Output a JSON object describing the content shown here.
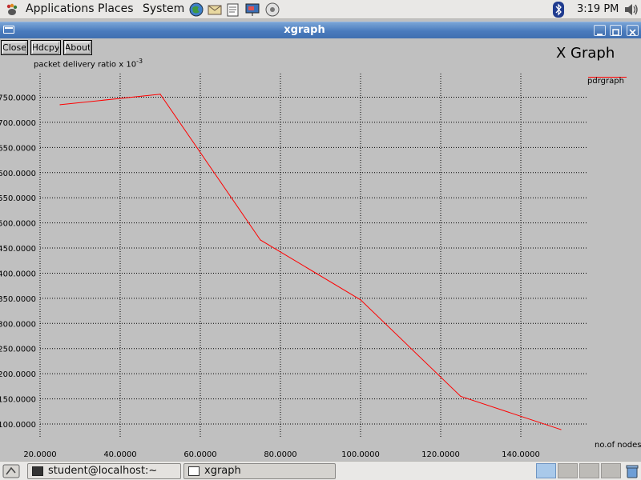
{
  "top_panel": {
    "menus": [
      "Applications",
      "Places",
      "System"
    ],
    "launchers": [
      "web-browser-icon",
      "mail-icon",
      "text-editor-icon",
      "presentation-icon",
      "help-icon"
    ],
    "clock": "3:19 PM"
  },
  "window": {
    "title": "xgraph"
  },
  "xgraph": {
    "buttons": {
      "close": "Close",
      "hdcpy": "Hdcpy",
      "about": "About"
    },
    "title": "X Graph",
    "y_label": "packet delivery ratio x 10",
    "y_label_exp": "-3",
    "x_label": "no.of nodes",
    "legend": "pdrgraph"
  },
  "chart_data": {
    "type": "line",
    "title": "X Graph",
    "xlabel": "no.of nodes",
    "ylabel": "packet delivery ratio x 10^-3",
    "x_ticks": [
      20,
      40,
      60,
      80,
      100,
      120,
      140
    ],
    "y_ticks": [
      100,
      150,
      200,
      250,
      300,
      350,
      400,
      450,
      500,
      550,
      600,
      650,
      700,
      750
    ],
    "x_tick_labels": [
      "20.0000",
      "40.0000",
      "60.0000",
      "80.0000",
      "100.0000",
      "120.0000",
      "140.0000"
    ],
    "y_tick_labels": [
      "100.0000",
      "150.0000",
      "200.0000",
      "250.0000",
      "300.0000",
      "350.0000",
      "400.0000",
      "450.0000",
      "500.0000",
      "550.0000",
      "600.0000",
      "650.0000",
      "700.0000",
      "750.0000"
    ],
    "xlim": [
      20,
      150
    ],
    "ylim": [
      90,
      760
    ],
    "grid": true,
    "legend_position": "top-right",
    "series": [
      {
        "name": "pdrgraph",
        "color": "#ff0000",
        "x": [
          25,
          50,
          75,
          100,
          125,
          150
        ],
        "y": [
          735,
          756,
          466,
          347,
          155,
          89
        ]
      }
    ]
  },
  "taskbar": {
    "tasks": [
      "student@localhost:~",
      "xgraph"
    ],
    "workspaces": 4
  }
}
